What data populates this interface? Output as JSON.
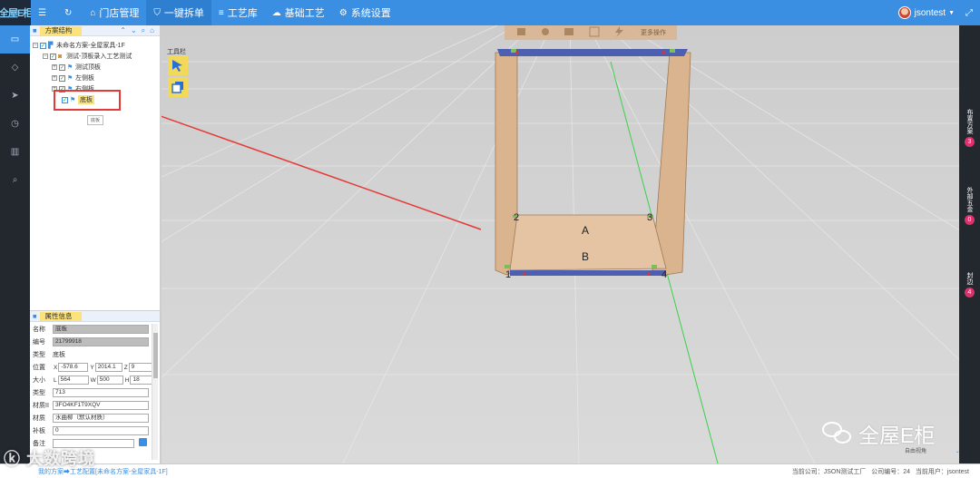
{
  "app": {
    "logo_text": "全屋E柜",
    "accent": "#3a8fe3",
    "user_name": "jsontest"
  },
  "nav": {
    "items": [
      {
        "icon": "menu-icon"
      },
      {
        "icon": "refresh-icon"
      },
      {
        "label": "门店管理",
        "icon": "home-icon"
      },
      {
        "label": "一键拆单",
        "icon": "shield-icon",
        "active": true
      },
      {
        "label": "工艺库",
        "icon": "bars-icon"
      },
      {
        "label": "基础工艺",
        "icon": "cloud-icon"
      },
      {
        "label": "系统设置",
        "icon": "gear-icon"
      }
    ]
  },
  "side_icons": [
    "card-icon",
    "diamond-icon",
    "send-icon",
    "clock-icon",
    "trash-icon",
    "search-icon"
  ],
  "tree_panel": {
    "title": "方案结构",
    "nodes": [
      {
        "label": "未命名方案-全屋家具-1F"
      },
      {
        "label": "测试-顶板录入工艺测试"
      },
      {
        "label": "测试顶板"
      },
      {
        "label": "左侧板"
      },
      {
        "label": "右侧板"
      },
      {
        "label": "底板",
        "selected": true
      }
    ],
    "tooltip": "底板"
  },
  "props_panel": {
    "title": "属性信息",
    "rows": {
      "name": {
        "key": "名称",
        "value": "底板"
      },
      "code": {
        "key": "编号",
        "value": "21799918"
      },
      "type": {
        "key": "类型",
        "value": "底板"
      },
      "position": {
        "key": "位置",
        "x": "-578.6",
        "y": "2014.1",
        "z": "9"
      },
      "size": {
        "key": "大小",
        "l": "564",
        "w": "500",
        "h": "18"
      },
      "type2": {
        "key": "类型",
        "value": "713"
      },
      "material_id": {
        "key": "材质II",
        "value": "3FO4KF1T9XQV"
      },
      "material": {
        "key": "材质",
        "value": "水曲柳（默认材质）"
      },
      "patch": {
        "key": "补板",
        "value": "0"
      },
      "note": {
        "key": "备注",
        "value": ""
      }
    }
  },
  "viewport": {
    "toolbox_label": "工具栏",
    "more_ops": "更多操作",
    "markers": [
      "1",
      "2",
      "3",
      "4"
    ],
    "faces": [
      "A",
      "B"
    ],
    "watermark": "全屋E柜",
    "view_mode": "自由视角"
  },
  "right_strip": [
    {
      "label": "布置方案",
      "count": "3"
    },
    {
      "label": "外部五金",
      "count": "0"
    },
    {
      "label": "封边",
      "count": "4"
    }
  ],
  "footer": {
    "breadcrumb": "我的方案➡工艺配置[未命名方案-全屋家具-1F]",
    "company": "当前公司：JSON测试工厂",
    "company_no": "公司编号：24",
    "current_user": "当前用户：jsontest"
  },
  "overlay_brand": "大数跨境"
}
